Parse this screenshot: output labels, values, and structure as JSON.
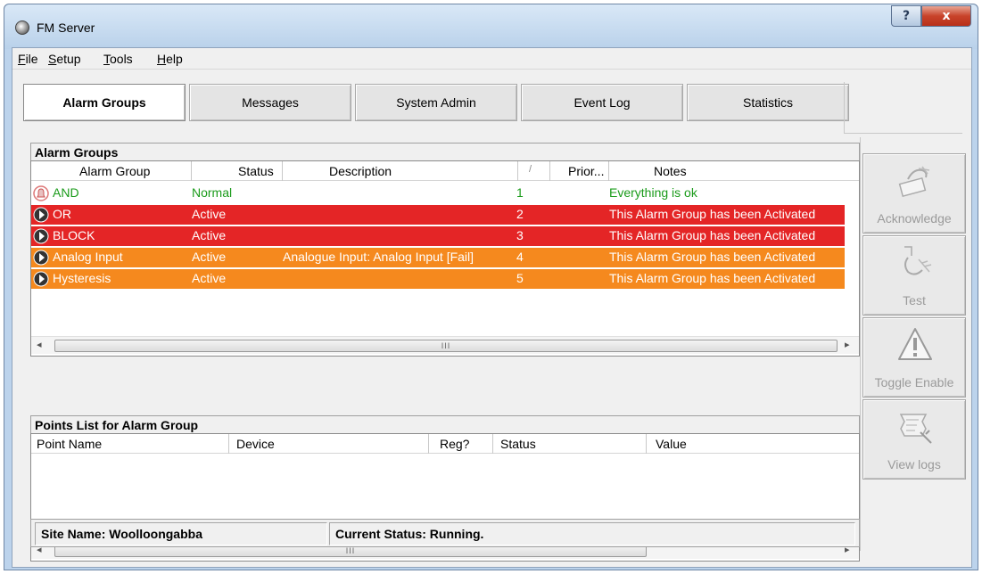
{
  "window": {
    "title": "FM Server",
    "help_button": "?",
    "close_button": "x"
  },
  "menu": [
    {
      "underline": "F",
      "rest": "ile"
    },
    {
      "underline": "S",
      "rest": "etup"
    },
    {
      "underline": "T",
      "rest": "ools"
    },
    {
      "underline": "H",
      "rest": "elp"
    }
  ],
  "tabs": [
    "Alarm Groups",
    "Messages",
    "System Admin",
    "Event Log",
    "Statistics"
  ],
  "alarm_groups": {
    "header": "Alarm Groups",
    "columns": [
      "Alarm Group",
      "Status",
      "Description",
      "/",
      "Prior...",
      "Notes"
    ],
    "rows": [
      {
        "name": "AND",
        "status": "Normal",
        "description": "",
        "priority": "1",
        "notes": "Everything is ok",
        "state": "normal"
      },
      {
        "name": "OR",
        "status": "Active",
        "description": "",
        "priority": "2",
        "notes": "This Alarm Group has been Activated",
        "state": "red"
      },
      {
        "name": "BLOCK",
        "status": "Active",
        "description": "",
        "priority": "3",
        "notes": "This Alarm Group has been Activated",
        "state": "red"
      },
      {
        "name": "Analog Input",
        "status": "Active",
        "description": "Analogue Input: Analog Input [Fail]",
        "priority": "4",
        "notes": "This Alarm Group has been Activated",
        "state": "orange"
      },
      {
        "name": "Hysteresis",
        "status": "Active",
        "description": "",
        "priority": "5",
        "notes": "This Alarm Group has been Activated",
        "state": "orange"
      }
    ],
    "scroll_left": "◂",
    "scroll_right": "▸",
    "scroll_thumb": "III"
  },
  "points_list": {
    "header": "Points List for Alarm Group",
    "columns": [
      "Point Name",
      "Device",
      "Reg?",
      "Status",
      "Value"
    ],
    "scroll_left": "◂",
    "scroll_right": "▸",
    "scroll_thumb": "III"
  },
  "status_bar": {
    "site": "Site Name: Woolloongabba",
    "status": "Current Status: Running."
  },
  "actions": [
    {
      "label": "Acknowledge",
      "icon": "acknowledge-icon"
    },
    {
      "label": "Test",
      "icon": "test-icon"
    },
    {
      "label": "Toggle Enable",
      "icon": "warning-icon"
    },
    {
      "label": "View logs",
      "icon": "view-logs-icon"
    }
  ],
  "colors": {
    "active_red": "#e42526",
    "active_orange": "#f5891e",
    "normal_green": "#1a9b1a"
  }
}
